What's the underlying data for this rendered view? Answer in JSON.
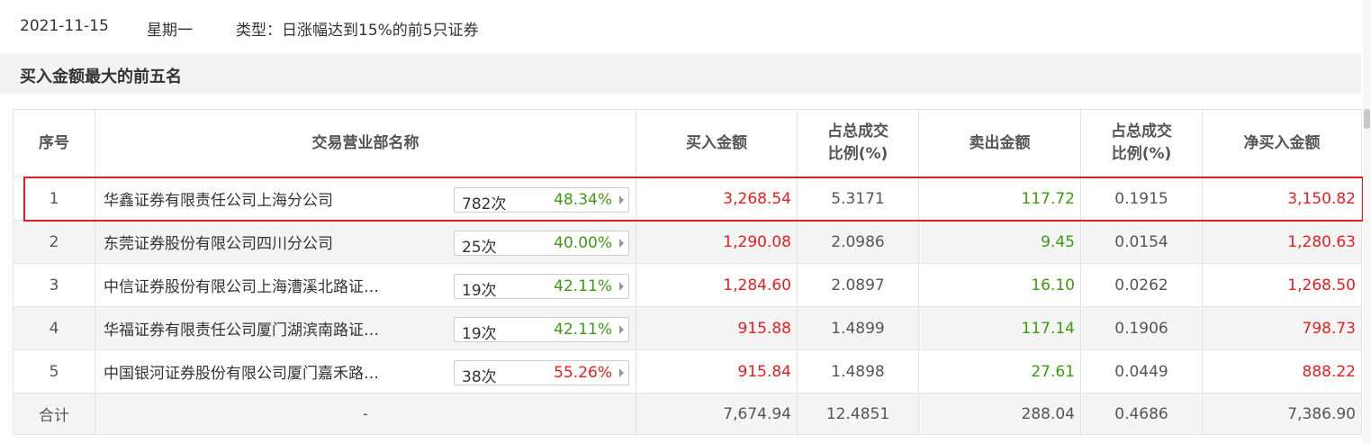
{
  "info": {
    "date": "2021-11-15",
    "weekday": "星期一",
    "type": "类型：日涨幅达到15%的前5只证券"
  },
  "section": {
    "title": "买入金额最大的前五名"
  },
  "table": {
    "headers": {
      "rank": "序号",
      "branch": "交易营业部名称",
      "buy_amount": "买入金额",
      "buy_ratio_line1": "占总成交",
      "buy_ratio_line2": "比例(%)",
      "sell_amount": "卖出金额",
      "sell_ratio_line1": "占总成交",
      "sell_ratio_line2": "比例(%)",
      "net_buy": "净买入金额"
    },
    "rows": [
      {
        "rank": "1",
        "branch": "华鑫证券有限责任公司上海分公司",
        "times": "782次",
        "win_rate": "48.34%",
        "buy_amount": "3,268.54",
        "buy_ratio": "5.3171",
        "sell_amount": "117.72",
        "sell_ratio": "0.1915",
        "net_buy": "3,150.82"
      },
      {
        "rank": "2",
        "branch": "东莞证券股份有限公司四川分公司",
        "times": "25次",
        "win_rate": "40.00%",
        "buy_amount": "1,290.08",
        "buy_ratio": "2.0986",
        "sell_amount": "9.45",
        "sell_ratio": "0.0154",
        "net_buy": "1,280.63"
      },
      {
        "rank": "3",
        "branch": "中信证券股份有限公司上海漕溪北路证…",
        "times": "19次",
        "win_rate": "42.11%",
        "buy_amount": "1,284.60",
        "buy_ratio": "2.0897",
        "sell_amount": "16.10",
        "sell_ratio": "0.0262",
        "net_buy": "1,268.50"
      },
      {
        "rank": "4",
        "branch": "华福证券有限责任公司厦门湖滨南路证…",
        "times": "19次",
        "win_rate": "42.11%",
        "buy_amount": "915.88",
        "buy_ratio": "1.4899",
        "sell_amount": "117.14",
        "sell_ratio": "0.1906",
        "net_buy": "798.73"
      },
      {
        "rank": "5",
        "branch": "中国银河证券股份有限公司厦门嘉禾路…",
        "times": "38次",
        "win_rate": "55.26%",
        "buy_amount": "915.84",
        "buy_ratio": "1.4898",
        "sell_amount": "27.61",
        "sell_ratio": "0.0449",
        "net_buy": "888.22"
      }
    ],
    "total": {
      "label": "合计",
      "branch": "-",
      "buy_amount": "7,674.94",
      "buy_ratio": "12.4851",
      "sell_amount": "288.04",
      "sell_ratio": "0.4686",
      "net_buy": "7,386.90"
    }
  },
  "colors": {
    "up": "#e81d1d",
    "down": "#3d9a0e",
    "highlight": "#e31f1f"
  }
}
